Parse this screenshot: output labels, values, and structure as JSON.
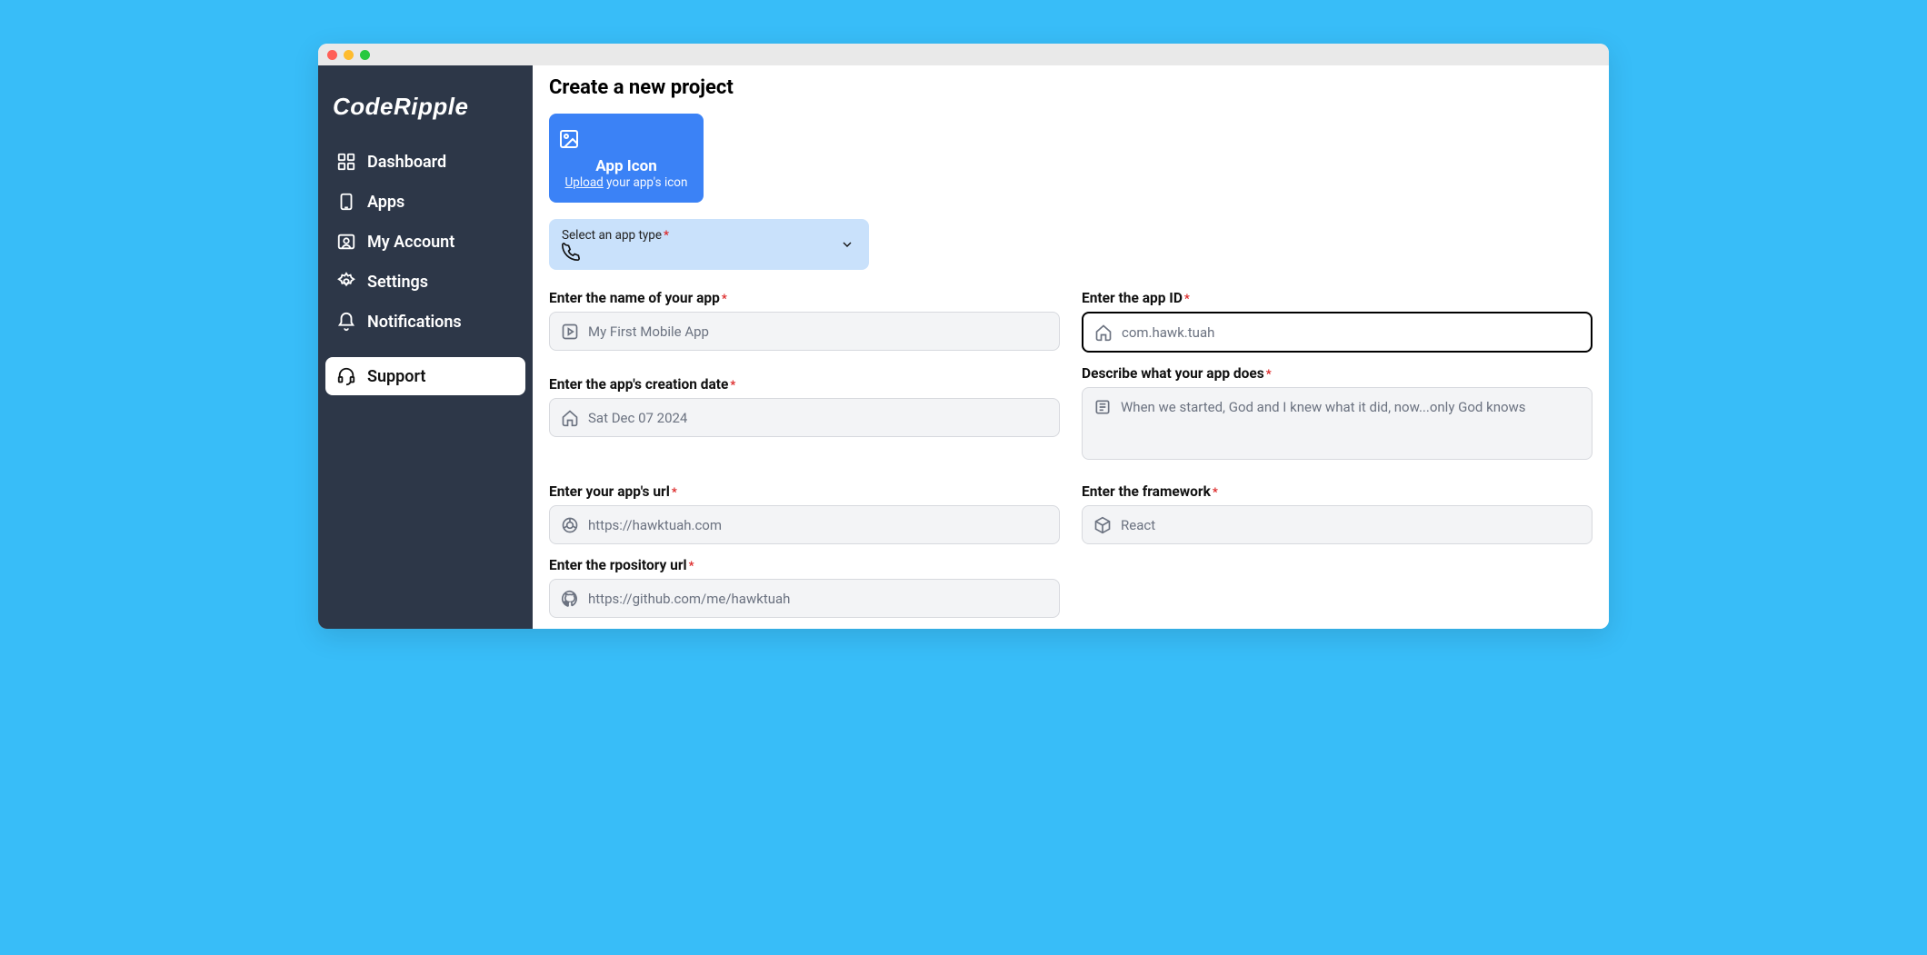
{
  "brand": "CodeRipple",
  "sidebar": {
    "items": [
      {
        "label": "Dashboard",
        "icon": "grid-icon",
        "active": false
      },
      {
        "label": "Apps",
        "icon": "device-icon",
        "active": false
      },
      {
        "label": "My Account",
        "icon": "user-badge-icon",
        "active": false
      },
      {
        "label": "Settings",
        "icon": "gear-icon",
        "active": false
      },
      {
        "label": "Notifications",
        "icon": "bell-icon",
        "active": false
      },
      {
        "label": "Support",
        "icon": "headset-icon",
        "active": true
      }
    ]
  },
  "page": {
    "title": "Create a new project"
  },
  "upload": {
    "title": "App Icon",
    "link": "Upload",
    "suffix": " your app's icon"
  },
  "select_app_type": {
    "label": "Select an app type",
    "icon": "phone-icon"
  },
  "fields": {
    "app_name": {
      "label": "Enter the name of your app",
      "placeholder": "My First Mobile App",
      "icon": "play-square-icon"
    },
    "app_id": {
      "label": "Enter the app ID",
      "placeholder": "com.hawk.tuah",
      "icon": "home-icon",
      "focused": true
    },
    "created": {
      "label": "Enter the app's creation date",
      "placeholder": "Sat Dec 07 2024",
      "icon": "home-icon"
    },
    "description": {
      "label": "Describe what your app does",
      "placeholder": "When we started, God and I knew what it did, now...only God knows",
      "icon": "newspaper-icon"
    },
    "url": {
      "label": "Enter your app's url",
      "placeholder": "https://hawktuah.com",
      "icon": "chrome-icon"
    },
    "framework": {
      "label": "Enter the framework",
      "placeholder": "React",
      "icon": "box-icon"
    },
    "repo": {
      "label": "Enter the rpository url",
      "placeholder": "https://github.com/me/hawktuah",
      "icon": "github-icon"
    }
  }
}
